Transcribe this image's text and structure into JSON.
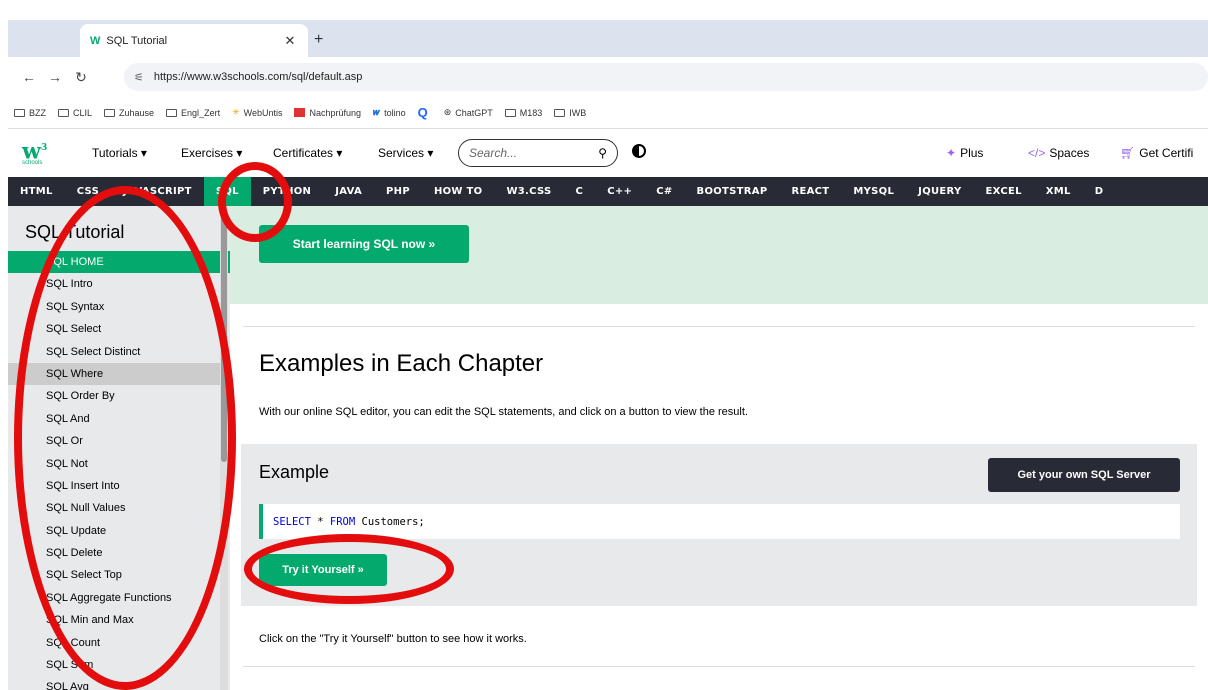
{
  "browser": {
    "tab_title": "SQL Tutorial",
    "tab_favicon": "W",
    "url": "https://www.w3schools.com/sql/default.asp",
    "bookmarks": [
      "BZZ",
      "CLIL",
      "Zuhause",
      "Engl_Zert",
      "WebUntis",
      "Nachprüfung",
      "tolino",
      "",
      "ChatGPT",
      "M183",
      "IWB"
    ]
  },
  "header": {
    "menu": [
      "Tutorials ▾",
      "Exercises ▾",
      "Certificates ▾",
      "Services ▾"
    ],
    "search_placeholder": "Search...",
    "right": [
      "Plus",
      "Spaces",
      "Get Certifi"
    ],
    "logo_sub": "schools"
  },
  "topnav": [
    "HTML",
    "CSS",
    "JAVASCRIPT",
    "SQL",
    "PYTHON",
    "JAVA",
    "PHP",
    "HOW TO",
    "W3.CSS",
    "C",
    "C++",
    "C#",
    "BOOTSTRAP",
    "REACT",
    "MYSQL",
    "JQUERY",
    "EXCEL",
    "XML",
    "D"
  ],
  "sidebar": {
    "title": "SQL Tutorial",
    "items": [
      "SQL HOME",
      "SQL Intro",
      "SQL Syntax",
      "SQL Select",
      "SQL Select Distinct",
      "SQL Where",
      "SQL Order By",
      "SQL And",
      "SQL Or",
      "SQL Not",
      "SQL Insert Into",
      "SQL Null Values",
      "SQL Update",
      "SQL Delete",
      "SQL Select Top",
      "SQL Aggregate Functions",
      "SQL Min and Max",
      "SQL Count",
      "SQL Sum",
      "SQL Avg"
    ],
    "active_index": 0,
    "hover_index": 5
  },
  "main": {
    "start_button": "Start learning SQL now »",
    "heading": "Examples in Each Chapter",
    "intro": "With our online SQL editor, you can edit the SQL statements, and click on a button to view the result.",
    "example_title": "Example",
    "own_server_button": "Get your own SQL Server",
    "code_kw1": "SELECT",
    "code_mid": " * ",
    "code_kw2": "FROM",
    "code_rest": " Customers;",
    "try_button": "Try it Yourself »",
    "footnote": "Click on the \"Try it Yourself\" button to see how it works."
  },
  "colors": {
    "accent": "#04aa6d",
    "nav_dark": "#282a35",
    "annotation": "#e30d0d"
  }
}
